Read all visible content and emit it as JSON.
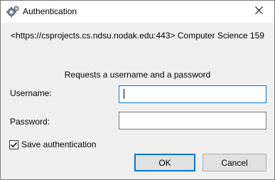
{
  "window": {
    "title": "Authentication",
    "icon": "gear-app-icon",
    "close_glyph": "✕"
  },
  "dialog": {
    "url_line": "<https://csprojects.cs.ndsu.nodak.edu:443> Computer Science 159",
    "prompt": "Requests a username and a password"
  },
  "form": {
    "username_label": "Username:",
    "username_value": "",
    "password_label": "Password:",
    "password_value": "",
    "save_label": "Save authentication",
    "save_checked": true
  },
  "buttons": {
    "ok": "OK",
    "cancel": "Cancel"
  },
  "colors": {
    "focus_accent": "#0078d7",
    "background": "#f0f0f0"
  }
}
